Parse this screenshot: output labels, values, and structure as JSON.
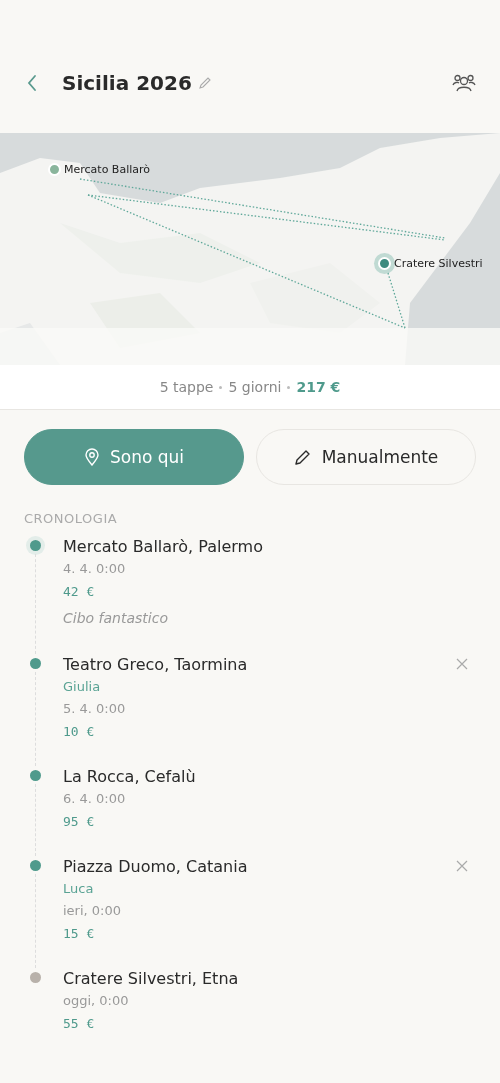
{
  "header": {
    "title": "Sicilia 2026"
  },
  "map": {
    "markers": [
      {
        "label": "Mercato Ballarò",
        "selected": false
      },
      {
        "label": "Cratere Silvestri",
        "selected": true
      }
    ]
  },
  "summary": {
    "stops": "5 tappe",
    "days": "5 giorni",
    "total": "217  €"
  },
  "actions": [
    {
      "label": "Sono qui",
      "kind": "location",
      "primary": true
    },
    {
      "label": "Manualmente",
      "kind": "edit",
      "primary": false
    }
  ],
  "timeline": {
    "title": "CRONOLOGIA",
    "items": [
      {
        "place": "Mercato Ballarò, Palermo",
        "date": "4. 4. 0:00",
        "amount": "42  €",
        "note": "Cibo fantastico",
        "kind": "current",
        "removable": false
      },
      {
        "place": "Teatro Greco, Taormina",
        "person": "Giulia",
        "date": "5. 4. 0:00",
        "amount": "10  €",
        "kind": "done",
        "removable": true
      },
      {
        "place": "La Rocca, Cefalù",
        "date": "6. 4. 0:00",
        "amount": "95  €",
        "kind": "done",
        "removable": false
      },
      {
        "place": "Piazza Duomo, Catania",
        "person": "Luca",
        "date": "ieri, 0:00",
        "amount": "15  €",
        "kind": "done",
        "removable": true
      },
      {
        "place": "Cratere Silvestri, Etna",
        "date": "oggi, 0:00",
        "amount": "55  €",
        "kind": "upcoming",
        "removable": false
      }
    ]
  }
}
